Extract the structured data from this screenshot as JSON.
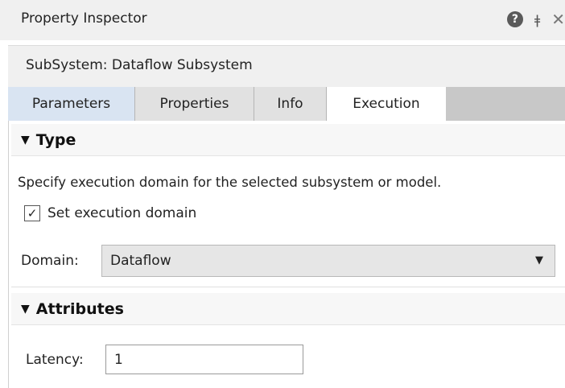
{
  "window": {
    "title": "Property Inspector"
  },
  "toolbar": {
    "help_icon": "help-icon",
    "pin_icon": "pin-icon",
    "close_icon": "close-icon"
  },
  "header": {
    "subsystem": "SubSystem: Dataflow Subsystem"
  },
  "tabs": [
    {
      "label": "Parameters"
    },
    {
      "label": "Properties"
    },
    {
      "label": "Info"
    },
    {
      "label": "Execution",
      "active": true
    }
  ],
  "type_section": {
    "title": "Type",
    "description": "Specify execution domain for the selected subsystem or model.",
    "checkbox_label": "Set execution domain",
    "checkbox_checked": true,
    "domain_label": "Domain:",
    "domain_value": "Dataflow"
  },
  "attributes_section": {
    "title": "Attributes",
    "latency_label": "Latency:",
    "latency_value": "1"
  }
}
